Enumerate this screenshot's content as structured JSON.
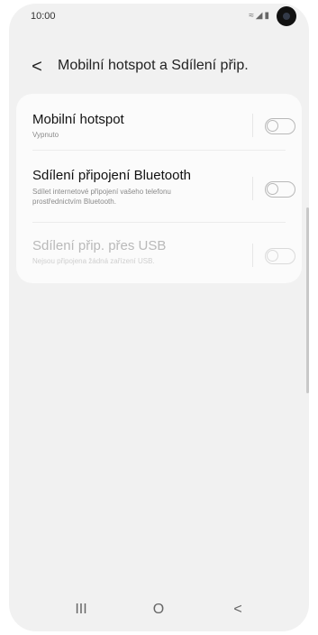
{
  "status_bar": {
    "time": "10:00",
    "icons": "wifi-icon signal-icon battery-icon"
  },
  "header": {
    "back_label": "<",
    "title": "Mobilní hotspot a Sdílení přip."
  },
  "settings": {
    "items": [
      {
        "title": "Mobilní hotspot",
        "subtitle": "Vypnuto",
        "enabled": true,
        "toggle_on": false
      },
      {
        "title": "Sdílení připojení Bluetooth",
        "subtitle": "Sdílet internetové připojení vašeho telefonu prostřednictvím Bluetooth.",
        "enabled": true,
        "toggle_on": false
      },
      {
        "title": "Sdílení přip. přes USB",
        "subtitle": "Nejsou připojena žádná zařízení USB.",
        "enabled": false,
        "toggle_on": false
      }
    ]
  },
  "nav": {
    "recents": "III",
    "home": "O",
    "back": "<"
  }
}
